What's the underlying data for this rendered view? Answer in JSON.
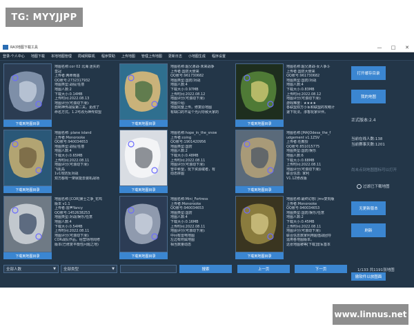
{
  "watermarks": {
    "top_left": "TG: MYYJJPP",
    "bottom_right": "www.linnus.net"
  },
  "window": {
    "title": "RA3地图下载工具",
    "controls": [
      "—",
      "□",
      "✕"
    ]
  },
  "menu": [
    "登录-个人中心",
    "地图下载",
    "本地地图管理",
    "局域网联机",
    "程序赞助",
    "上传地图",
    "管理上传地图",
    "更新日志",
    "小地图生成",
    "程序设置"
  ],
  "download_label": "下载到地图目录",
  "maps": [
    {
      "lines": [
        "地图名称:cor 02 北海 迷失的",
        "皇冠",
        "上传者:两命雨墨",
        "QQ账号:2732317932",
        "地图类型:战役/任意",
        "地图人数:2",
        "下载大小:0.14MB",
        "上传时间:2022.08.13",
        "地图评分(可滚动下滑):",
        "自制神传战役第二关。更改了",
        "命名方式。1.2可改为神传双盟"
      ],
      "colors": {
        "bg": "#2b3c52",
        "land": "#7e8fa8",
        "accent": "#c8d2e0"
      }
    },
    {
      "lines": [
        "地图名称:超兄弟战-未来战争",
        "上传者:国防大使来",
        "QQ账号:961730682",
        "地图类型:国防/对战",
        "地图人数:4",
        "下载大小:0.97MB",
        "上传时间:2022.08.12",
        "地图评分(可滚动下滑):",
        "地图介绍:",
        "地图完整上传。修复原地图",
        "有缺口的不是个光闪导致大家的"
      ],
      "colors": {
        "bg": "#2f6f8f",
        "land": "#c9b27a",
        "accent": "#3e6a40"
      }
    },
    {
      "lines": [
        "地图名称:超兄弟战-女人争斗",
        "上传者:国防大使来",
        "QQ账号:961730682",
        "地图类型:国防/对战",
        "地图人数:4",
        "下载大小:0.83MB",
        "上传时间:2022.08.12",
        "地图评分(可滚动下滑):",
        "游戏难度：★★★★",
        "各联盟双方小军和联盟的攻略计",
        "速下玩法。渗香玩家伙伴。"
      ],
      "colors": {
        "bg": "#1e2e1e",
        "land": "#4f7a36",
        "accent": "#d8cf7a"
      }
    },
    {
      "lines": [
        "地图名称: plane island",
        "上传者:Monorooke",
        "QQ账号:940034653",
        "地图类型:战役/任意",
        "地图人数:4",
        "下载大小:0.65MB",
        "上传时间:2022.08.11",
        "地图评分(可滚动下滑):",
        "飞机岛",
        "1v1攻防反对战",
        "双方都有一架就能去装机战场"
      ],
      "colors": {
        "bg": "#2a5878",
        "land": "#b2a472",
        "accent": "#6d5e3e"
      }
    },
    {
      "lines": [
        "地图名称:hope_in_the_snow",
        "上传者:coing",
        "QQ账号:1901420956",
        "地图类型:国防",
        "地图人数:2",
        "下载大小:0.48MB",
        "上传时间:2022.08.11",
        "地图评分(可滚动下滑):",
        "雪中希望，玩下资源或者，有",
        "动态拼图"
      ],
      "colors": {
        "bg": "#d9dde3",
        "land": "#f3f4f6",
        "accent": "#6b7077"
      }
    },
    {
      "lines": [
        "地图名称:[MA]Odesa_the_f",
        "udgement v1.1ZSV",
        "上传者:任教授",
        "QQ账号:851015775",
        "地图类型:国防/娱乐",
        "地图人数:6",
        "下载大小:0.68MB",
        "上传时间:2022.08.11",
        "地图评分(可滚动下滑):",
        "联合信息: 家利",
        "V1.1Z修改版"
      ],
      "colors": {
        "bg": "#5a6a7a",
        "land": "#a89a78",
        "accent": "#4b5565"
      }
    },
    {
      "lines": [
        "地图名称:[COR]第士之争_花鸡",
        "版本 v1.1",
        "上传者:雷声Yancy",
        "QQ账号:1452638253",
        "地图类型:对战/娱乐/任意",
        "地图人数:4",
        "下载大小:0.54MB",
        "上传时间:2022.08.11",
        "地图评分(可滚动下滑):",
        "COR战队作品。经营场地周修",
        "版本(已修复平衡性问题之地)"
      ],
      "colors": {
        "bg": "#6f7a85",
        "land": "#c2c8ce",
        "accent": "#3b4c66"
      }
    },
    {
      "lines": [
        "地图名称:Mini_Fortress",
        "上传者:Monorooke",
        "QQ账号:940034653",
        "地图类型:国防",
        "地图人数:4",
        "下载大小:0.16MB",
        "上传时间:2022.08.11",
        "地图评分(可滚动下滑):",
        "中间有雷电地图",
        "左边有附属地图",
        "相当数量动态"
      ],
      "colors": {
        "bg": "#2c3c55",
        "land": "#8f9aae",
        "accent": "#cfd6e2"
      }
    },
    {
      "lines": [
        "地图名称:最终幻想门mv复刻版",
        "上传者:Monorooke",
        "QQ账号:940034653",
        "地图类型:国防/娱乐/任意",
        "地图人数:2",
        "下载大小:0.45MB",
        "上传时间:2022.08.11",
        "地图评分(可滚动下滑):",
        "联合信息数家利用超值战团导",
        "运用各地图版本。",
        "这张地图被等[下载]雷军基本"
      ],
      "colors": {
        "bg": "#3a3520",
        "land": "#8a7c3e",
        "accent": "#d6c98a"
      }
    }
  ],
  "sidebar": {
    "open_dir": "打开缓存目录",
    "my_maps": "我的地图",
    "version": "正式版本:2.4",
    "online": "当前在线人数:138",
    "downloads": "当前赛事天数:1201",
    "watermark_hint": "尚未点到地图图标可以打开",
    "filter_label": "过滤已下载地图",
    "no_update": "无更新版本",
    "refresh": "刷新",
    "batch_dl": "撤软件以放图面"
  },
  "bottom": {
    "players_select": "全部人数",
    "type_select": "全部类型",
    "search_placeholder": "",
    "search_btn": "搜索",
    "prev": "上一页",
    "next": "下一页",
    "page_info": "1/133 共1191张地图"
  }
}
